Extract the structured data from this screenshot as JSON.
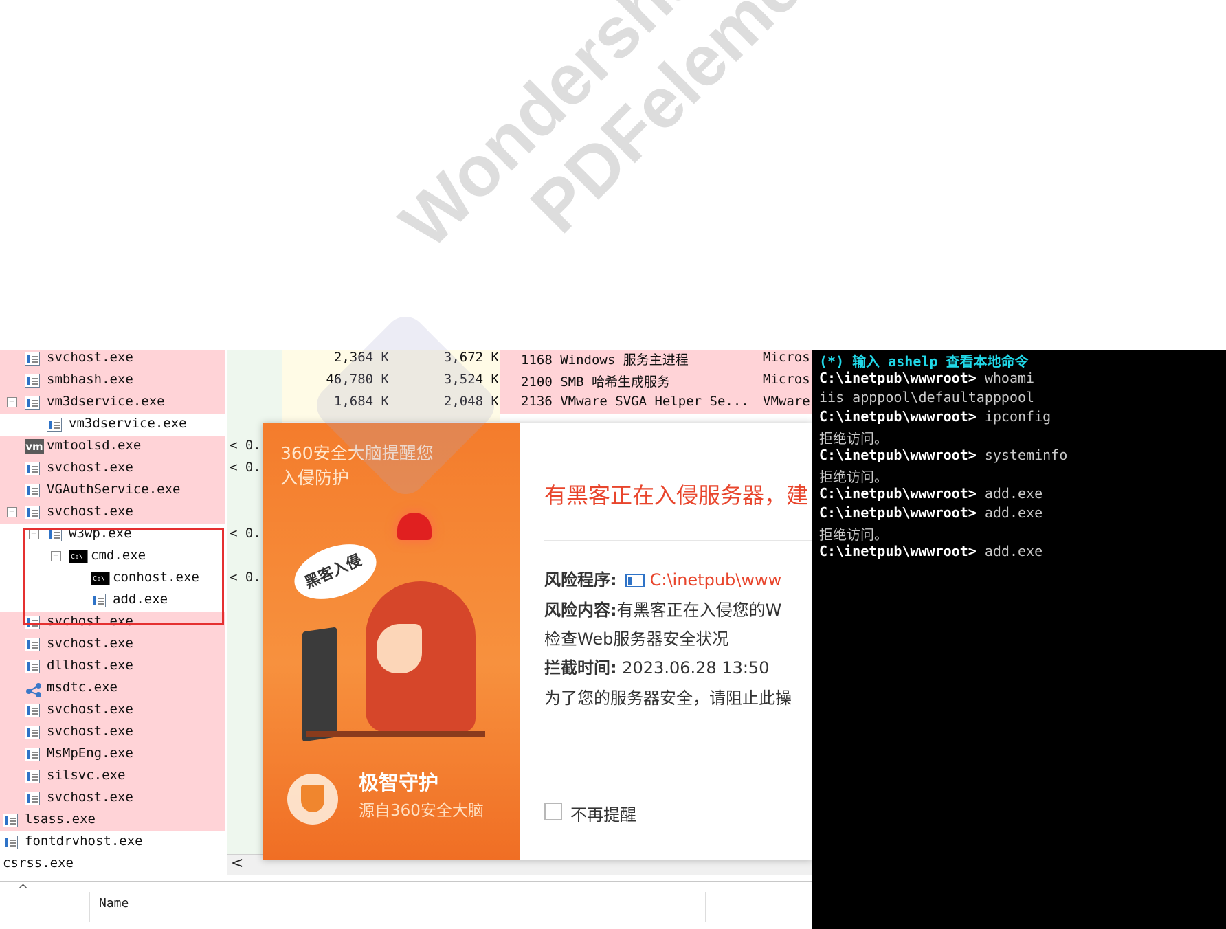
{
  "process_explorer": {
    "rows": [
      {
        "name": "svchost.exe",
        "cpu": "",
        "private": "2,364 K",
        "working": "3,672 K",
        "pid": "1168",
        "description": "Windows 服务主进程",
        "company": "Micros"
      },
      {
        "name": "smbhash.exe",
        "cpu": "",
        "private": "46,780 K",
        "working": "3,524 K",
        "pid": "2100",
        "description": "SMB 哈希生成服务",
        "company": "Micros"
      },
      {
        "name": "vm3dservice.exe",
        "cpu": "",
        "private": "1,684 K",
        "working": "2,048 K",
        "pid": "2136",
        "description": "VMware SVGA Helper Se...",
        "company": "VMware"
      },
      {
        "name": "vm3dservice.exe",
        "cpu": ""
      },
      {
        "name": "vmtoolsd.exe",
        "cpu": "< 0."
      },
      {
        "name": "svchost.exe",
        "cpu": "< 0."
      },
      {
        "name": "VGAuthService.exe",
        "cpu": ""
      },
      {
        "name": "svchost.exe",
        "cpu": ""
      },
      {
        "name": "w3wp.exe",
        "cpu": "< 0."
      },
      {
        "name": "cmd.exe",
        "cpu": ""
      },
      {
        "name": "conhost.exe",
        "cpu": "< 0."
      },
      {
        "name": "add.exe",
        "cpu": ""
      },
      {
        "name": "svchost.exe",
        "cpu": ""
      },
      {
        "name": "svchost.exe",
        "cpu": ""
      },
      {
        "name": "dllhost.exe",
        "cpu": ""
      },
      {
        "name": "msdtc.exe",
        "cpu": ""
      },
      {
        "name": "svchost.exe",
        "cpu": ""
      },
      {
        "name": "svchost.exe",
        "cpu": ""
      },
      {
        "name": "MsMpEng.exe",
        "cpu": ""
      },
      {
        "name": "silsvc.exe",
        "cpu": ""
      },
      {
        "name": "svchost.exe",
        "cpu": ""
      },
      {
        "name": "lsass.exe",
        "cpu": ""
      },
      {
        "name": "fontdrvhost.exe",
        "cpu": ""
      },
      {
        "name": "csrss.exe",
        "cpu": ""
      }
    ],
    "header_name": "Name",
    "scroll_left": "<",
    "collapse_symbol": "⊟",
    "caret": "^"
  },
  "popup": {
    "brand": "360安全大脑提醒您",
    "subtitle": "入侵防护",
    "bubble_text": "黑客入侵",
    "alert_title": "有黑客正在入侵服务器，建",
    "risk_program_label": "风险程序:",
    "risk_program_path": "C:\\inetpub\\www",
    "risk_content_label": "风险内容:",
    "risk_content_text": "有黑客正在入侵您的W",
    "check_text": "检查Web服务器安全状况",
    "intercept_label": "拦截时间:",
    "intercept_time": "2023.06.28 13:50",
    "advice": "为了您的服务器安全，请阻止此操",
    "dont_remind": "不再提醒",
    "footer_title": "极智守护",
    "footer_sub": "源自360安全大脑",
    "accent": "#f47c2c",
    "alert_color": "#e8452c"
  },
  "terminal": {
    "help_line": "(*) 输入 ashelp 查看本地命令",
    "prompt": "C:\\inetpub\\wwwroot>",
    "lines": [
      {
        "cmd": "whoami"
      },
      {
        "out": "iis apppool\\defaultapppool"
      },
      {
        "cmd": "ipconfig"
      },
      {
        "out": "拒绝访问。"
      },
      {
        "cmd": "systeminfo"
      },
      {
        "out": "拒绝访问。"
      },
      {
        "cmd": "add.exe"
      },
      {
        "cmd": "add.exe"
      },
      {
        "out": "拒绝访问。"
      },
      {
        "cmd": "add.exe"
      }
    ]
  },
  "watermark": {
    "line1": "Wondershare",
    "line2": "PDFelement"
  }
}
